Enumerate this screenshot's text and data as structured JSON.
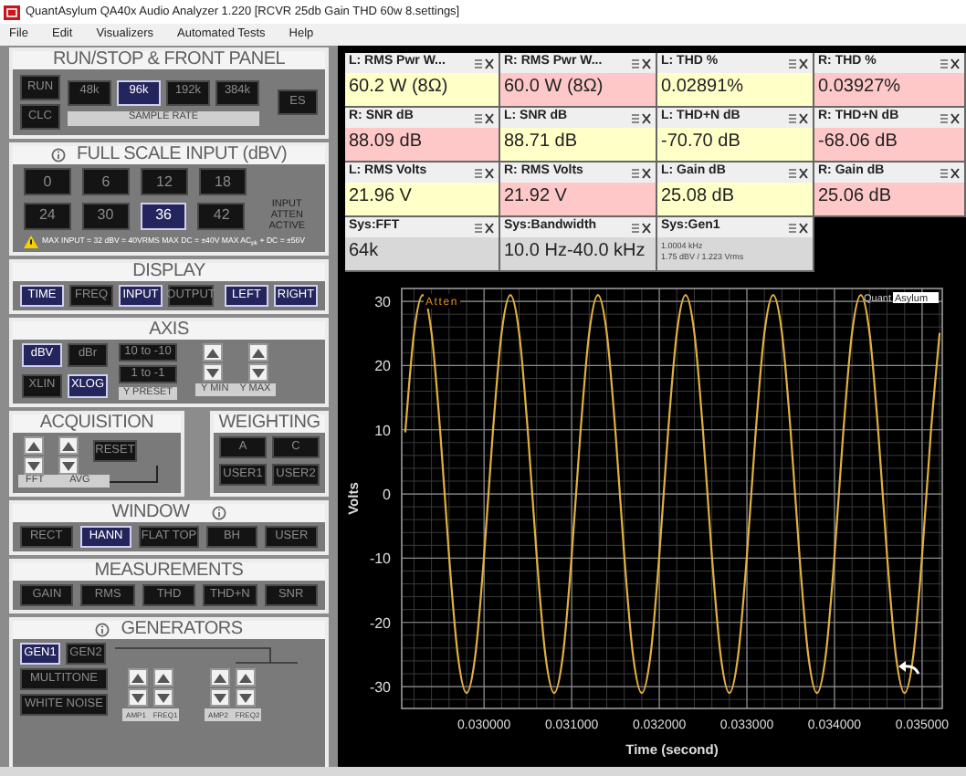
{
  "window": {
    "title": "QuantAsylum QA40x Audio Analyzer 1.220 [RCVR 25db Gain THD 60w 8.settings]"
  },
  "menu": [
    "File",
    "Edit",
    "Visualizers",
    "Automated Tests",
    "Help"
  ],
  "run_stop": {
    "title": "RUN/STOP & FRONT PANEL",
    "left_buttons": [
      {
        "label": "RUN",
        "selected": false
      },
      {
        "label": "CLC",
        "selected": false
      }
    ],
    "sample_rates": [
      {
        "label": "48k",
        "selected": false
      },
      {
        "label": "96k",
        "selected": true
      },
      {
        "label": "192k",
        "selected": false
      },
      {
        "label": "384k",
        "selected": false
      }
    ],
    "sample_rate_label": "SAMPLE RATE",
    "right_button": {
      "label": "ES",
      "selected": false
    }
  },
  "full_scale_input": {
    "title": "FULL SCALE INPUT (dBV)",
    "levels": [
      {
        "label": "0",
        "selected": false
      },
      {
        "label": "6",
        "selected": false
      },
      {
        "label": "12",
        "selected": false
      },
      {
        "label": "18",
        "selected": false
      },
      {
        "label": "24",
        "selected": false
      },
      {
        "label": "30",
        "selected": false
      },
      {
        "label": "36",
        "selected": true
      },
      {
        "label": "42",
        "selected": false
      }
    ],
    "atten_label": "INPUT ATTEN ACTIVE",
    "warning": "MAX INPUT = 32 dBV = 40VRMS   MAX DC = ±40V   MAX AC$_{pk}$ + DC = ±56V"
  },
  "display": {
    "title": "DISPLAY",
    "buttons": [
      {
        "label": "TIME",
        "selected": true
      },
      {
        "label": "FREQ",
        "selected": false
      },
      {
        "label": "INPUT",
        "selected": true
      },
      {
        "label": "OUTPUT",
        "selected": false
      },
      {
        "label": "LEFT",
        "selected": true
      },
      {
        "label": "RIGHT",
        "selected": true
      }
    ]
  },
  "axis": {
    "title": "AXIS",
    "units": [
      {
        "label": "dBV",
        "selected": true
      },
      {
        "label": "dBr",
        "selected": false
      },
      {
        "label": "XLIN",
        "selected": false
      },
      {
        "label": "XLOG",
        "selected": true
      }
    ],
    "presets": [
      "10 to -10",
      "1 to -1"
    ],
    "preset_label": "Y PRESET",
    "y_min_label": "Y MIN",
    "y_max_label": "Y MAX"
  },
  "acquisition": {
    "title": "ACQUISITION",
    "fft_label": "FFT",
    "avg_label": "AVG",
    "reset": "RESET"
  },
  "weighting": {
    "title": "WEIGHTING",
    "buttons": [
      {
        "label": "A",
        "selected": false
      },
      {
        "label": "C",
        "selected": false
      },
      {
        "label": "USER1",
        "selected": false
      },
      {
        "label": "USER2",
        "selected": false
      }
    ]
  },
  "window_panel": {
    "title": "WINDOW",
    "buttons": [
      {
        "label": "RECT",
        "selected": false
      },
      {
        "label": "HANN",
        "selected": true
      },
      {
        "label": "FLAT TOP",
        "selected": false
      },
      {
        "label": "BH",
        "selected": false
      },
      {
        "label": "USER",
        "selected": false
      }
    ]
  },
  "measurements": {
    "title": "MEASUREMENTS",
    "buttons": [
      {
        "label": "GAIN",
        "selected": false
      },
      {
        "label": "RMS",
        "selected": false
      },
      {
        "label": "THD",
        "selected": false
      },
      {
        "label": "THD+N",
        "selected": false
      },
      {
        "label": "SNR",
        "selected": false
      }
    ]
  },
  "generators": {
    "title": "GENERATORS",
    "gens": [
      {
        "label": "GEN1",
        "selected": true
      },
      {
        "label": "GEN2",
        "selected": false
      }
    ],
    "modes": [
      {
        "label": "MULTITONE",
        "selected": false
      },
      {
        "label": "WHITE NOISE",
        "selected": false
      }
    ],
    "controls": [
      "AMP1",
      "FREQ1",
      "AMP2",
      "FREQ2"
    ]
  },
  "readouts": [
    {
      "label": "L: RMS Pwr W...",
      "value": "60.2 W (8Ω)",
      "color": "#ffffc8"
    },
    {
      "label": "R: RMS Pwr W...",
      "value": "60.0 W (8Ω)",
      "color": "#ffc8c8"
    },
    {
      "label": "L: THD %",
      "value": "0.02891%",
      "color": "#ffffc8"
    },
    {
      "label": "R: THD %",
      "value": "0.03927%",
      "color": "#ffc8c8"
    },
    {
      "label": "R: SNR dB",
      "value": "88.09 dB",
      "color": "#ffc8c8"
    },
    {
      "label": "L: SNR dB",
      "value": "88.71 dB",
      "color": "#ffffc8"
    },
    {
      "label": "L: THD+N dB",
      "value": "-70.70 dB",
      "color": "#ffffc8"
    },
    {
      "label": "R: THD+N dB",
      "value": "-68.06 dB",
      "color": "#ffc8c8"
    },
    {
      "label": "L: RMS Volts",
      "value": "21.96 V",
      "color": "#ffffc8"
    },
    {
      "label": "R: RMS Volts",
      "value": "21.92 V",
      "color": "#ffc8c8"
    },
    {
      "label": "L: Gain dB",
      "value": "25.08 dB",
      "color": "#ffffc8"
    },
    {
      "label": "R: Gain dB",
      "value": "25.06 dB",
      "color": "#ffc8c8"
    },
    {
      "label": "Sys:FFT",
      "value": "64k",
      "color": "#d8d8d8"
    },
    {
      "label": "Sys:Bandwidth",
      "value": "10.0 Hz-40.0 kHz",
      "color": "#d8d8d8"
    },
    {
      "label": "Sys:Gen1",
      "value_lines": [
        "1.0004 kHz",
        "1.75 dBV / 1.223 Vrms"
      ],
      "color": "#d8d8d8"
    }
  ],
  "plot": {
    "overlay_label": "Atten",
    "logo": {
      "left": "Quant",
      "right": "Asylum"
    },
    "chart_data": {
      "type": "line",
      "xlabel": "Time (second)",
      "ylabel": "Volts",
      "x": [
        0.0291,
        0.0292,
        0.0293,
        0.0294,
        0.0295,
        0.0296,
        0.0297,
        0.0298,
        0.0299,
        0.03,
        0.0301,
        0.0302,
        0.0303,
        0.0304,
        0.0305,
        0.0306,
        0.0307,
        0.0308,
        0.0309,
        0.031,
        0.0311,
        0.0312,
        0.0313,
        0.0314,
        0.0315,
        0.0316,
        0.0317,
        0.0318,
        0.0319,
        0.032,
        0.0321,
        0.0322,
        0.0323,
        0.0324,
        0.0325,
        0.0326,
        0.0327,
        0.0328,
        0.0329,
        0.033,
        0.0331,
        0.0332,
        0.0333,
        0.0334,
        0.0335,
        0.0336,
        0.0337,
        0.0338,
        0.0339,
        0.034,
        0.0341,
        0.0342,
        0.0343,
        0.0344,
        0.0345,
        0.0346,
        0.0347,
        0.0348,
        0.0349,
        0.035,
        0.0351,
        0.0352
      ],
      "grid": true,
      "series": [
        {
          "color": "#e0b040",
          "values": [
            9.6,
            25.1,
            31,
            25.1,
            9.6,
            -9.6,
            -25.1,
            -31,
            -25.1,
            -9.6,
            9.6,
            25.1,
            31,
            25.1,
            9.6,
            -9.6,
            -25.1,
            -31,
            -25.1,
            -9.6,
            9.6,
            25.1,
            31,
            25.1,
            9.6,
            -9.6,
            -25.1,
            -31,
            -25.1,
            -9.6,
            9.6,
            25.1,
            31,
            25.1,
            9.6,
            -9.6,
            -25.1,
            -31,
            -25.1,
            -9.6,
            9.6,
            25.1,
            31,
            25.1,
            9.6,
            -9.6,
            -25.1,
            -31,
            -25.1,
            -9.6,
            9.6,
            25.1,
            31,
            25.1,
            9.6,
            -9.6,
            -25.1,
            -31,
            -25.1,
            -9.6,
            9.6,
            25.1
          ]
        }
      ],
      "xlim": [
        0.02906,
        0.03523
      ],
      "ylim": [
        -33.4,
        32
      ],
      "xticks": [
        {
          "value": 0.03,
          "label": "0.030000"
        },
        {
          "value": 0.031,
          "label": "0.031000"
        },
        {
          "value": 0.032,
          "label": "0.032000"
        },
        {
          "value": 0.033,
          "label": "0.033000"
        },
        {
          "value": 0.034,
          "label": "0.034000"
        },
        {
          "value": 0.035,
          "label": "0.035000"
        }
      ],
      "yticks": [
        -30,
        -20,
        -10,
        0,
        10,
        20,
        30
      ]
    }
  }
}
